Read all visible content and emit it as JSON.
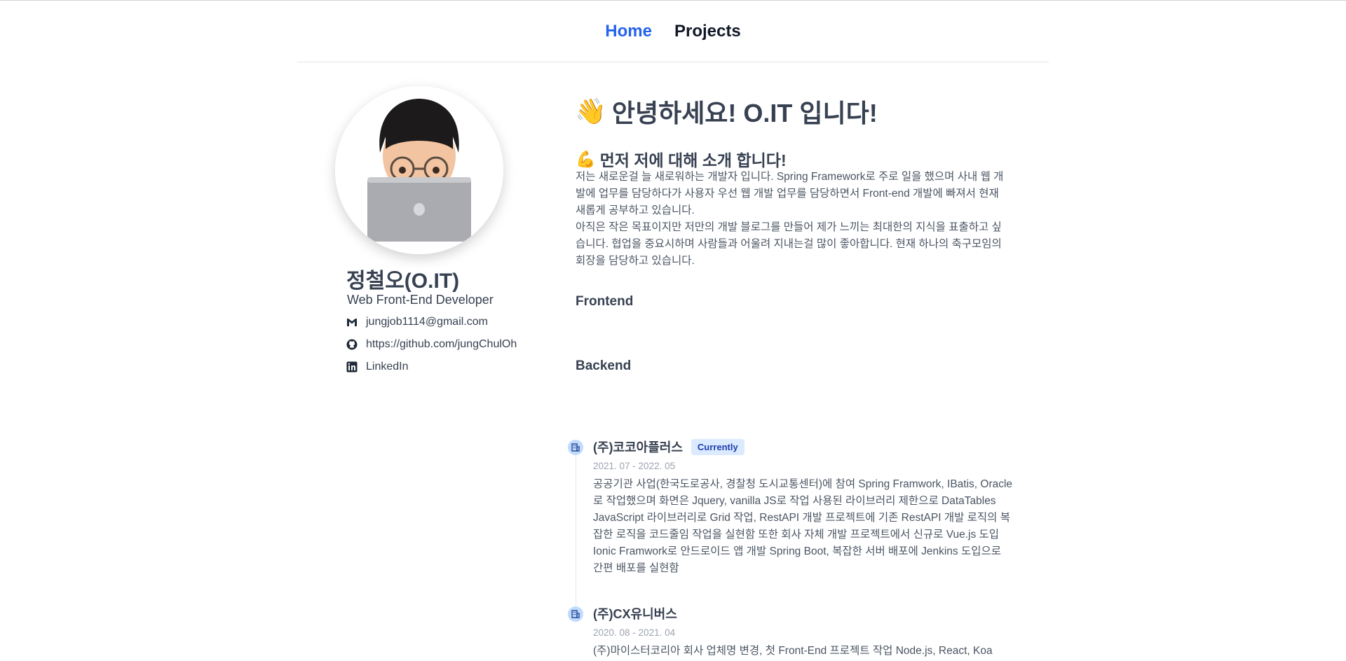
{
  "nav": {
    "items": [
      {
        "label": "Home",
        "active": true
      },
      {
        "label": "Projects",
        "active": false
      }
    ]
  },
  "profile": {
    "avatar_icon": "memoji-laptop-avatar",
    "name": "정철오(O.IT)",
    "role": "Web Front-End Developer",
    "contacts": [
      {
        "icon": "gmail-icon",
        "text": "jungjob1114@gmail.com"
      },
      {
        "icon": "github-icon",
        "text": "https://github.com/jungChulOh"
      },
      {
        "icon": "linkedin-icon",
        "text": "LinkedIn"
      }
    ]
  },
  "about": {
    "greeting_emoji": "👋",
    "greeting": "안녕하세요! O.IT 입니다!",
    "intro_emoji": "💪",
    "intro_title": "먼저 저에 대해 소개 합니다!",
    "paragraph1": "저는 새로운걸 늘 새로워하는 개발자 입니다. Spring Framework로 주로 일을 했으며 사내 웹 개발에 업무를 담당하다가 사용자 우선 웹 개발 업무를 담당하면서 Front-end 개발에 빠져서 현재 새롭게 공부하고 있습니다.",
    "paragraph2": "아직은 작은 목표이지만 저만의 개발 블로그를 만들어 제가 느끼는 최대한의 지식을 표출하고 싶습니다. 협업을 중요시하며 사람들과 어울려 지내는걸 많이 좋아합니다. 현재 하나의 축구모임의 회장을 담당하고 있습니다."
  },
  "skills": {
    "frontend_label": "Frontend",
    "backend_label": "Backend"
  },
  "experience": [
    {
      "company": "(주)코코아플러스",
      "badge": "Currently",
      "period": "2021. 07 - 2022. 05",
      "description": "공공기관 사업(한국도로공사, 경찰청 도시교통센터)에 참여 Spring Framwork, IBatis, Oracle로 작업했으며 화면은 Jquery, vanilla JS로 작업 사용된 라이브러리 제한으로 DataTables JavaScript 라이브러리로 Grid 작업, RestAPI 개발 프로젝트에 기존 RestAPI 개발 로직의 복잡한 로직을 코드줄임 작업을 실현함 또한 회사 자체 개발 프로젝트에서 신규로 Vue.js 도입 Ionic Framwork로 안드로이드 앱 개발 Spring Boot, 복잡한 서버 배포에 Jenkins 도입으로 간편 배포를 실현함"
    },
    {
      "company": "(주)CX유니버스",
      "badge": "",
      "period": "2020. 08 - 2021. 04",
      "description": "(주)마이스터코리아 회사 업체명 변경, 첫 Front-End 프로젝트 작업 Node.js, React, Koa"
    }
  ],
  "colors": {
    "accent": "#2563eb",
    "badge_bg": "#dbeafe",
    "badge_text": "#1e40af"
  }
}
